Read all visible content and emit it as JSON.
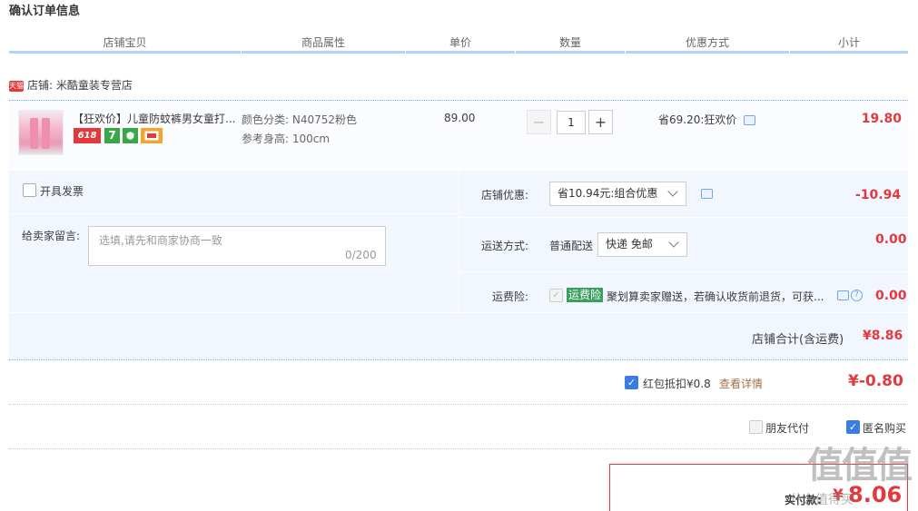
{
  "page_title": "确认订单信息",
  "columns": [
    "店铺宝贝",
    "商品属性",
    "单价",
    "数量",
    "优惠方式",
    "小计"
  ],
  "shop": {
    "badge": "天猫",
    "label": "店铺: 米酷童装专营店"
  },
  "item": {
    "title": "【狂欢价】儿童防蚊裤男女童打...",
    "promo_tags": [
      "618",
      "7"
    ],
    "attr_color": "颜色分类:  N40752粉色",
    "attr_height": "参考身高:  100cm",
    "price": "89.00",
    "qty_minus": "−",
    "qty": "1",
    "qty_plus": "+",
    "discount": "省69.20:狂欢价",
    "subtotal": "19.80"
  },
  "invoice_label": "开具发票",
  "message": {
    "label": "给卖家留言:",
    "placeholder": "选填,请先和商家协商一致",
    "count": "0/200"
  },
  "shop_discount": {
    "label": "店铺优惠:",
    "value": "省10.94元:组合优惠",
    "amount": "-10.94"
  },
  "shipping": {
    "label": "运送方式:",
    "type": "普通配送",
    "value": "快递 免邮",
    "amount": "0.00"
  },
  "insurance": {
    "label": "运费险:",
    "tag": "运费险",
    "text": "聚划算卖家赠送，若确认收货前退货，可获...",
    "help": "?",
    "amount": "0.00"
  },
  "shop_total": {
    "label": "店铺合计(含运费)",
    "amount": "¥8.86"
  },
  "red_packet": {
    "label": "红包抵扣¥0.8",
    "link": "查看详情",
    "amount": "¥-0.80"
  },
  "friend_pay_label": "朋友代付",
  "anonymous_label": "匿名购买",
  "payment": {
    "label": "实付款:",
    "yen": "¥",
    "amount": "8.06"
  },
  "watermark": "值值值",
  "watermark_sub": "什么值得买",
  "colors": {
    "accent_red": "#e4393c",
    "header_line": "#b2d1ff",
    "panel_bg": "#f2f7ff",
    "checkbox_blue": "#3a7ce2",
    "insurance_green": "#3a9e5e"
  }
}
